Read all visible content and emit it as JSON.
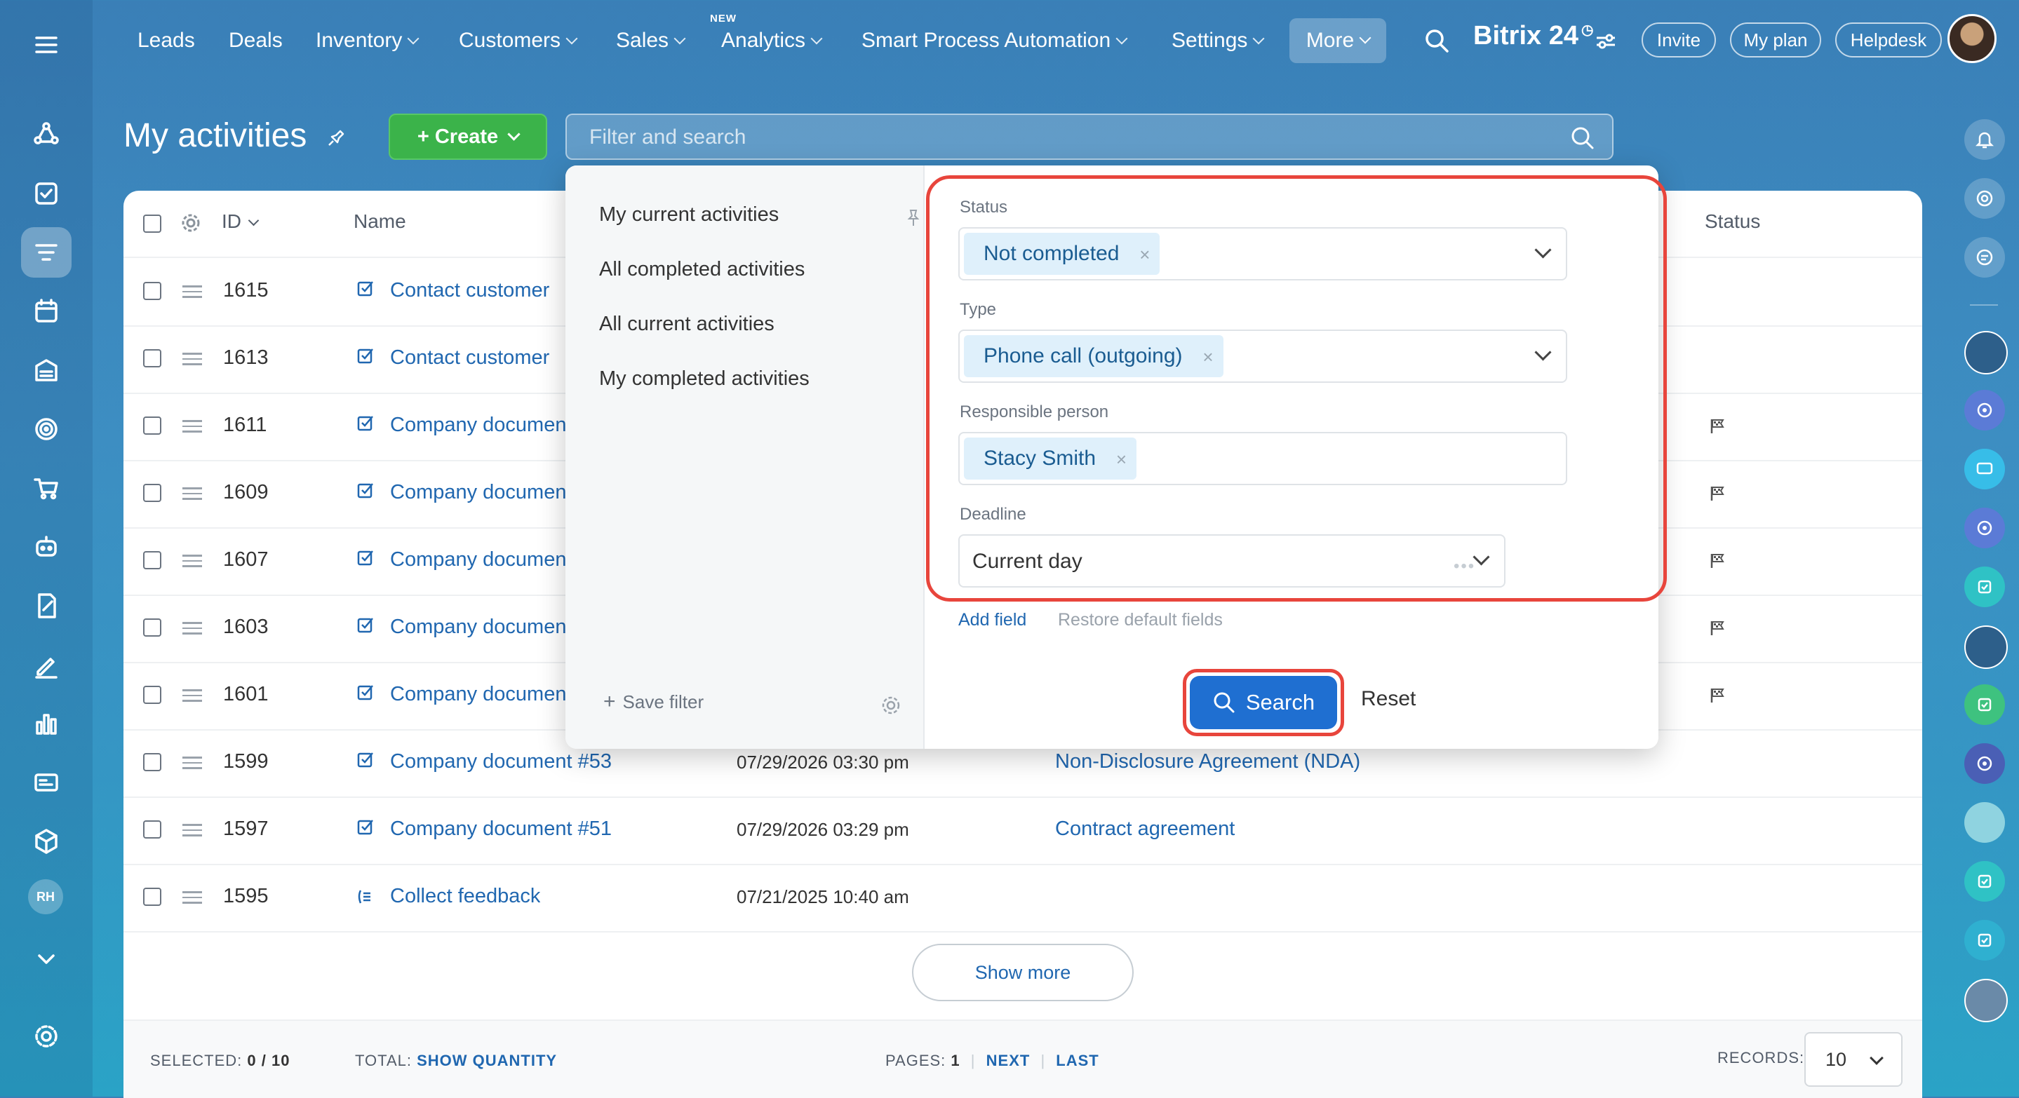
{
  "topnav": {
    "items": [
      "Leads",
      "Deals",
      "Inventory",
      "Customers",
      "Sales",
      "Analytics",
      "Smart Process Automation",
      "Settings"
    ],
    "new_badge": "NEW",
    "more": "More",
    "brand": "Bitrix 24",
    "invite": "Invite",
    "my_plan": "My plan",
    "helpdesk": "Helpdesk"
  },
  "page": {
    "title": "My activities",
    "create_label": "+ Create",
    "search_placeholder": "Filter and search"
  },
  "grid": {
    "col_id": "ID",
    "col_name": "Name",
    "col_status": "Status",
    "rows": [
      {
        "id": "1615",
        "name": "Contact customer",
        "date": "",
        "deal": "",
        "flag": false
      },
      {
        "id": "1613",
        "name": "Contact customer",
        "date": "",
        "deal": "",
        "flag": false
      },
      {
        "id": "1611",
        "name": "Company documen",
        "date": "",
        "deal": "",
        "flag": true
      },
      {
        "id": "1609",
        "name": "Company documen",
        "date": "",
        "deal": "",
        "flag": true
      },
      {
        "id": "1607",
        "name": "Company documen",
        "date": "",
        "deal": "",
        "flag": true
      },
      {
        "id": "1603",
        "name": "Company documen",
        "date": "",
        "deal": "",
        "flag": true
      },
      {
        "id": "1601",
        "name": "Company documen",
        "date": "",
        "deal": "",
        "flag": true
      },
      {
        "id": "1599",
        "name": "Company document #53",
        "date": "07/29/2026 03:30 pm",
        "deal": "Non-Disclosure Agreement (NDA)",
        "flag": false
      },
      {
        "id": "1597",
        "name": "Company document #51",
        "date": "07/29/2026 03:29 pm",
        "deal": "Contract agreement",
        "flag": false
      },
      {
        "id": "1595",
        "name": "Collect feedback",
        "date": "07/21/2025 10:40 am",
        "deal": "",
        "flag": false
      }
    ],
    "show_more": "Show more"
  },
  "footer": {
    "selected_label": "SELECTED:",
    "selected_value": "0 / 10",
    "total_label": "TOTAL:",
    "total_link": "SHOW QUANTITY",
    "pages_label": "PAGES:",
    "pages_value": "1",
    "next": "NEXT",
    "last": "LAST",
    "records_label": "RECORDS:",
    "records_value": "10"
  },
  "filter": {
    "presets": [
      "My current activities",
      "All completed activities",
      "All current activities",
      "My completed activities"
    ],
    "save_filter": "Save filter",
    "fields": {
      "status_label": "Status",
      "status_value": "Not completed",
      "type_label": "Type",
      "type_value": "Phone call (outgoing)",
      "responsible_label": "Responsible person",
      "responsible_value": "Stacy Smith",
      "deadline_label": "Deadline",
      "deadline_value": "Current day"
    },
    "add_field": "Add field",
    "restore_defaults": "Restore default fields",
    "search": "Search",
    "reset": "Reset"
  },
  "sidebar": {
    "avatar_initials": "RH"
  },
  "colors": {
    "highlight": "#e8453c",
    "primary": "#1f6fd1",
    "create": "#3bb34a",
    "link": "#2067b0"
  }
}
